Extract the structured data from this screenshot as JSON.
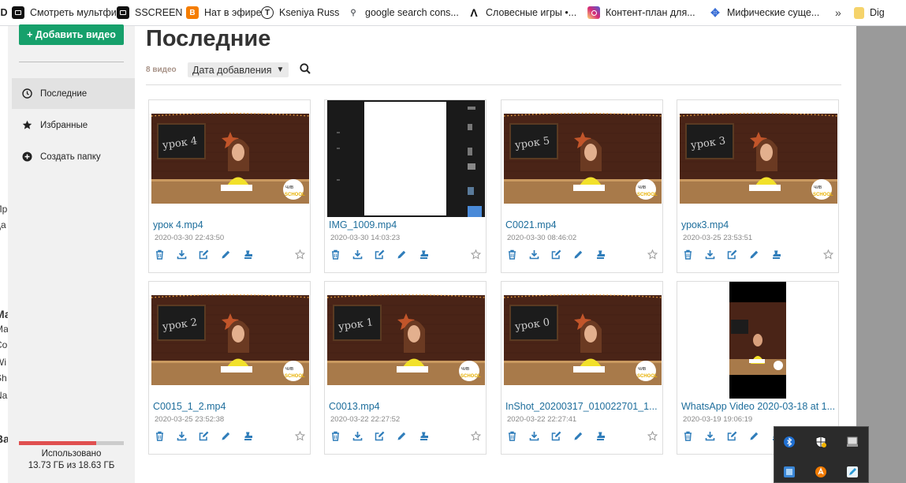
{
  "bookmarks": [
    {
      "label": "ID",
      "icon": "prev-bookmark-icon"
    },
    {
      "label": "Смотреть мультфи...",
      "icon": "film-icon"
    },
    {
      "label": "SSCREEN",
      "icon": "screen-icon"
    },
    {
      "label": "Нат в эфире",
      "icon": "blogger-icon"
    },
    {
      "label": "Kseniya Russ",
      "icon": "t-circle-icon"
    },
    {
      "label": "google search cons...",
      "icon": "search-console-icon"
    },
    {
      "label": "Словесные игры •...",
      "icon": "a-logo-icon"
    },
    {
      "label": "Контент-план для...",
      "icon": "instagram-icon"
    },
    {
      "label": "Мифические суще...",
      "icon": "cross-logo-icon"
    },
    {
      "label": "»",
      "icon": "more-icon"
    },
    {
      "label": "Dig",
      "icon": "folder-icon"
    }
  ],
  "bg_fragments": [
    "Пр",
    "да",
    "Ма",
    "Ма",
    "Co",
    "Wi",
    "Sh",
    "Na",
    "Ва"
  ],
  "sidebar": {
    "add_button": "+ Добавить видео",
    "items": [
      {
        "label": "Последние",
        "icon": "clock-icon",
        "active": true
      },
      {
        "label": "Избранные",
        "icon": "star-icon",
        "active": false
      },
      {
        "label": "Создать папку",
        "icon": "plus-circle-icon",
        "active": false
      }
    ],
    "usage_label": "Использовано",
    "usage_value": "13.73 ГБ из 18.63 ГБ",
    "usage_fraction": 0.737,
    "usage_color": "#e05050"
  },
  "main": {
    "title": "Последние",
    "count": "8 видео",
    "sort_label": "Дата добавления",
    "sort_caret": "▼"
  },
  "videos": [
    {
      "name": "урок 4.mp4",
      "date": "2020-03-30 22:43:50",
      "thumb": "scene",
      "board": "урок 4"
    },
    {
      "name": "IMG_1009.mp4",
      "date": "2020-03-30 14:03:23",
      "thumb": "screen",
      "board": ""
    },
    {
      "name": "C0021.mp4",
      "date": "2020-03-30 08:46:02",
      "thumb": "scene",
      "board": "урок 5"
    },
    {
      "name": "урок3.mp4",
      "date": "2020-03-25 23:53:51",
      "thumb": "scene",
      "board": "урок 3"
    },
    {
      "name": "C0015_1_2.mp4",
      "date": "2020-03-25 23:52:38",
      "thumb": "scene",
      "board": "урок 2"
    },
    {
      "name": "C0013.mp4",
      "date": "2020-03-22 22:27:52",
      "thumb": "scene",
      "board": "урок 1"
    },
    {
      "name": "InShot_20200317_010022701_1...",
      "date": "2020-03-22 22:27:41",
      "thumb": "scene",
      "board": "урок 0"
    },
    {
      "name": "WhatsApp Video 2020-03-18 at 1...",
      "date": "2020-03-19 19:06:19",
      "thumb": "vertical",
      "board": ""
    }
  ],
  "actions": [
    "trash-icon",
    "download-icon",
    "edit-box-icon",
    "pencil-icon",
    "stamp-icon",
    "star-outline-icon"
  ],
  "tray": [
    "bluetooth-icon",
    "shield-icon",
    "drive-icon",
    "network-icon",
    "avast-icon",
    "pen-tray-icon"
  ]
}
